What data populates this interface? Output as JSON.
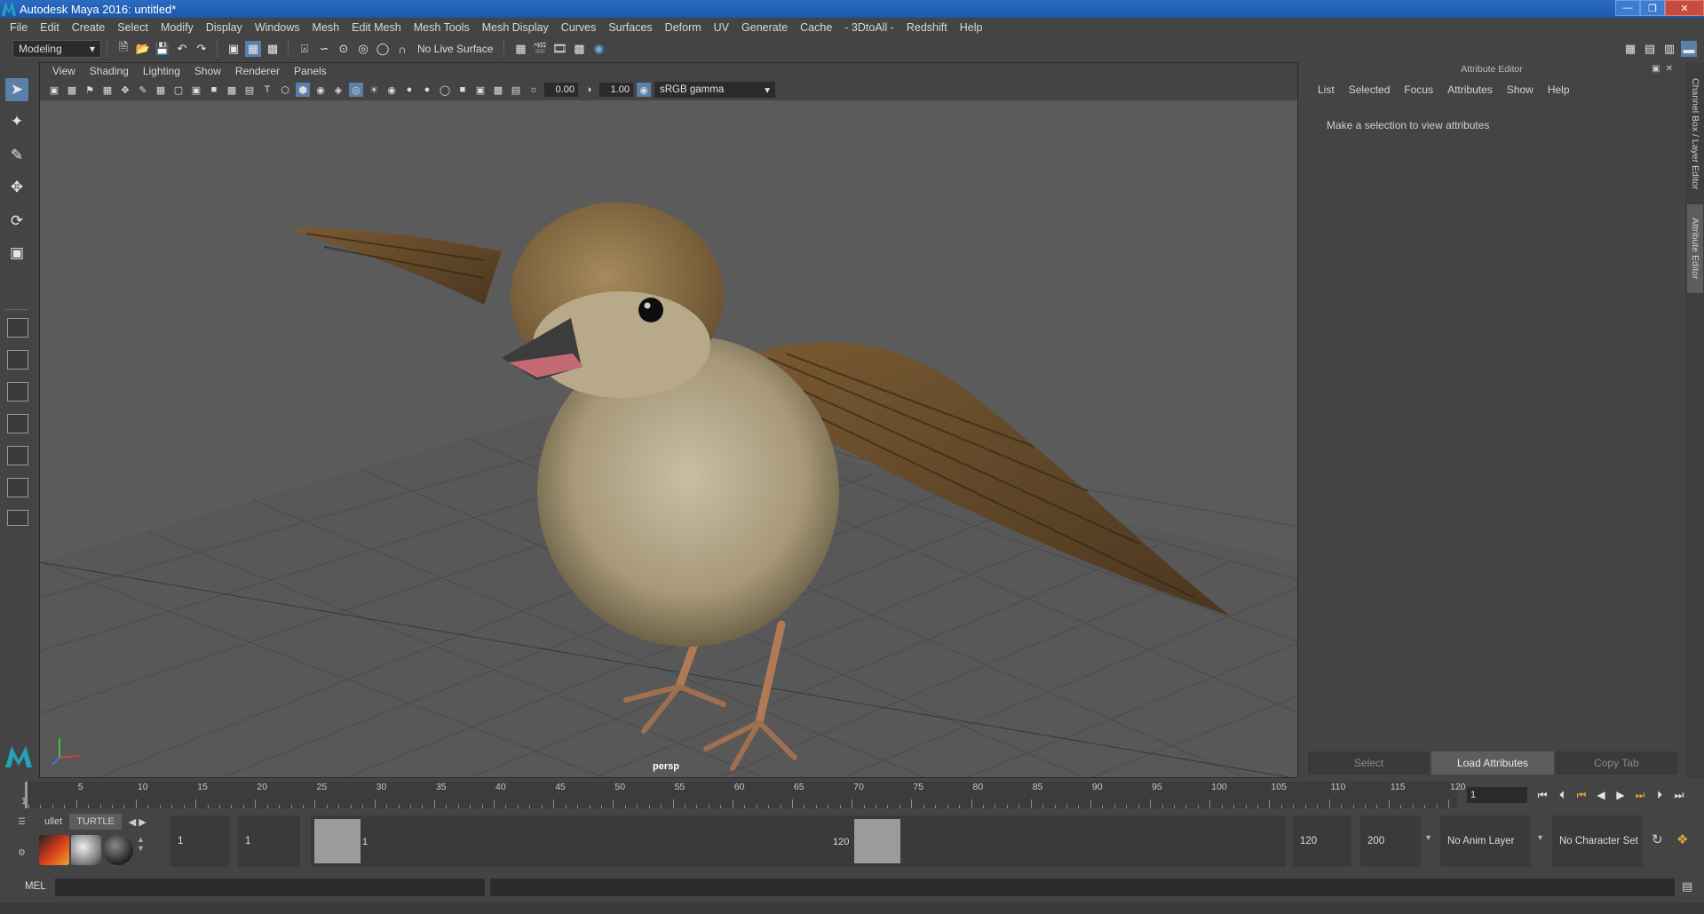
{
  "window": {
    "title": "Autodesk Maya 2016: untitled*"
  },
  "menubar": [
    "File",
    "Edit",
    "Create",
    "Select",
    "Modify",
    "Display",
    "Windows",
    "Mesh",
    "Edit Mesh",
    "Mesh Tools",
    "Mesh Display",
    "Curves",
    "Surfaces",
    "Deform",
    "UV",
    "Generate",
    "Cache",
    "- 3DtoAll -",
    "Redshift",
    "Help"
  ],
  "toolbar": {
    "mode": "Modeling",
    "live_surface": "No Live Surface"
  },
  "viewport": {
    "menu": [
      "View",
      "Shading",
      "Lighting",
      "Show",
      "Renderer",
      "Panels"
    ],
    "exposure": "0.00",
    "gamma": "1.00",
    "color_space": "sRGB gamma",
    "camera": "persp"
  },
  "attribute_editor": {
    "title": "Attribute Editor",
    "menu": [
      "List",
      "Selected",
      "Focus",
      "Attributes",
      "Show",
      "Help"
    ],
    "message": "Make a selection to view attributes",
    "buttons": {
      "select": "Select",
      "load": "Load Attributes",
      "copy": "Copy Tab"
    },
    "side_tabs": {
      "channel_box": "Channel Box / Layer Editor",
      "attribute_editor": "Attribute Editor"
    }
  },
  "timeline": {
    "ticks": [
      "1",
      "5",
      "10",
      "15",
      "20",
      "25",
      "30",
      "35",
      "40",
      "45",
      "50",
      "55",
      "60",
      "65",
      "70",
      "75",
      "80",
      "85",
      "90",
      "95",
      "100",
      "105",
      "110",
      "115",
      "120"
    ],
    "current_frame": "1"
  },
  "range": {
    "start": "1",
    "playback_start": "1",
    "handle_start": "1",
    "handle_end": "120",
    "playback_end": "120",
    "end": "200",
    "anim_layer": "No Anim Layer",
    "character_set": "No Character Set"
  },
  "shelf": {
    "tabs": [
      "ullet",
      "TURTLE"
    ]
  },
  "command_line": {
    "label": "MEL"
  },
  "colors": {
    "accent": "#5a7fa8",
    "panel": "#444444",
    "viewport": "#5b5b5b"
  }
}
